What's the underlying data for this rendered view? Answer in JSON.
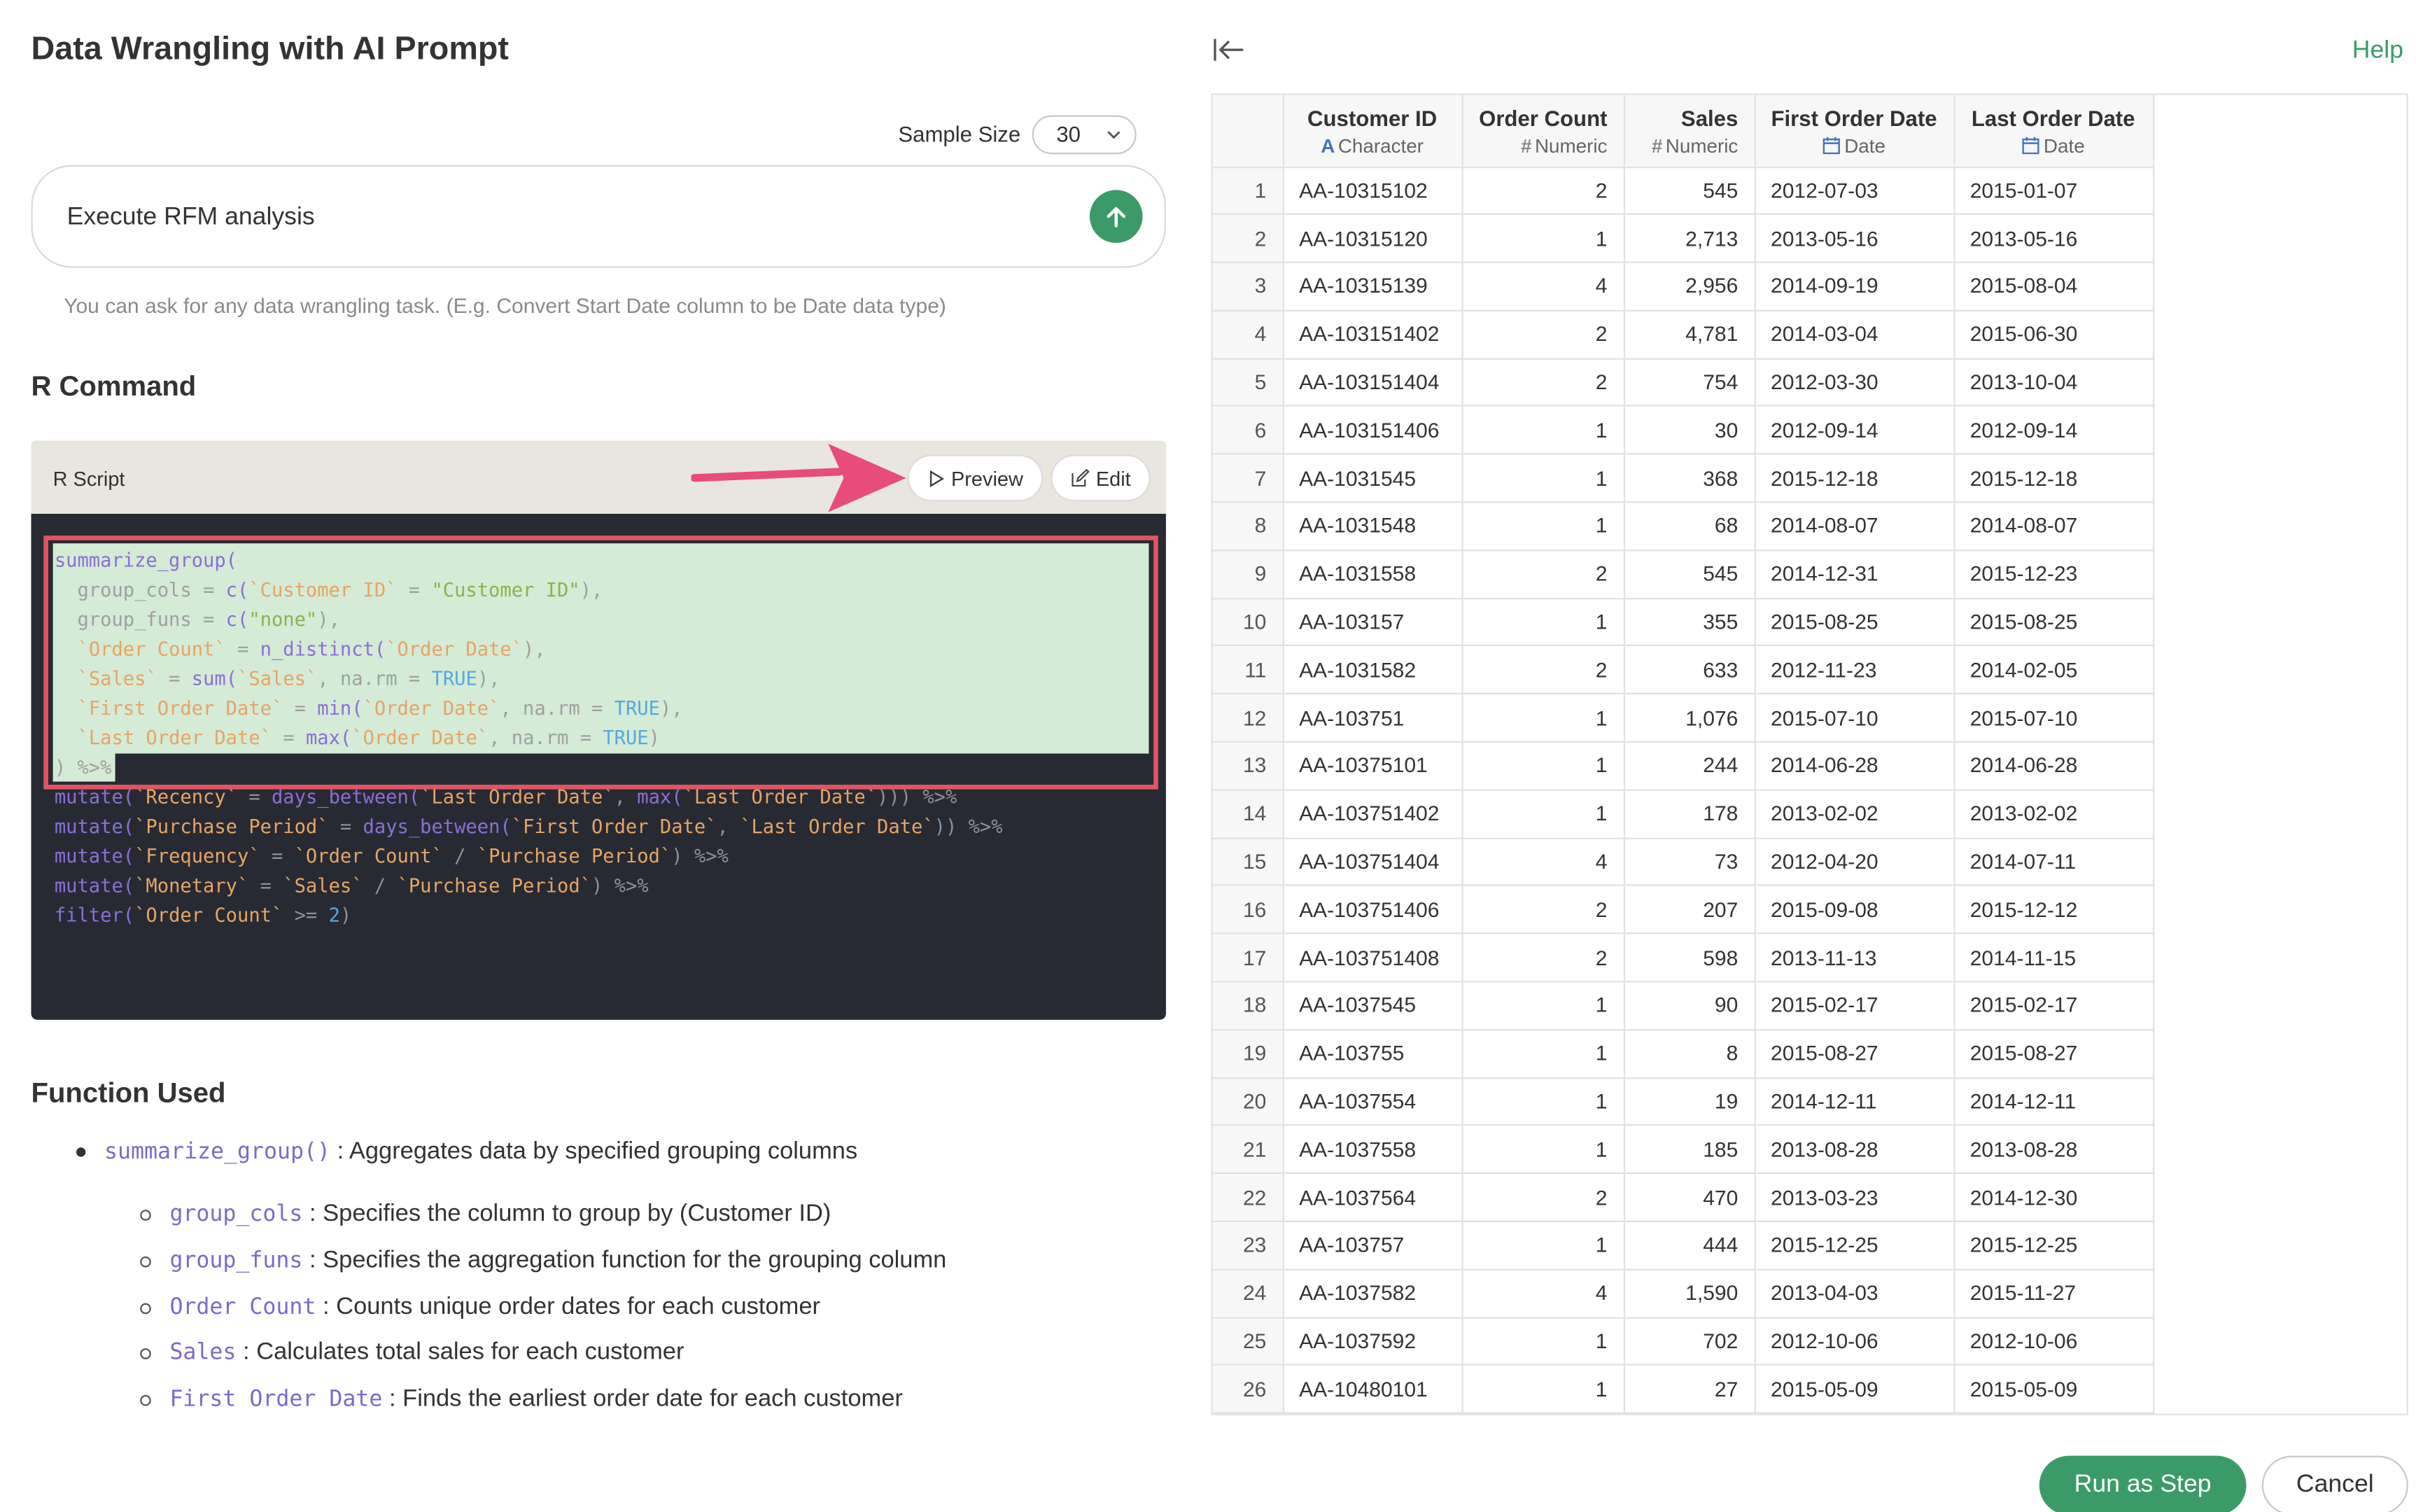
{
  "header": {
    "title": "Data Wrangling with AI Prompt",
    "help_label": "Help"
  },
  "sample": {
    "label": "Sample Size",
    "value": "30"
  },
  "prompt": {
    "text": "Execute RFM analysis",
    "hint": "You can ask for any data wrangling task. (E.g. Convert Start Date column to be Date data type)"
  },
  "r_command": {
    "heading": "R Command",
    "script_label": "R Script",
    "preview_label": "Preview",
    "edit_label": "Edit"
  },
  "code": {
    "l1": "summarize_group(",
    "l2a": "  group_cols = ",
    "l2b": "c(",
    "l2c": "`Customer ID`",
    "l2d": " = ",
    "l2e": "\"Customer ID\"",
    "l2f": "),",
    "l3a": "  group_funs = ",
    "l3b": "c(",
    "l3c": "\"none\"",
    "l3d": "),",
    "l4a": "  ",
    "l4b": "`Order Count`",
    "l4c": " = ",
    "l4d": "n_distinct(",
    "l4e": "`Order Date`",
    "l4f": "),",
    "l5a": "  ",
    "l5b": "`Sales`",
    "l5c": " = ",
    "l5d": "sum(",
    "l5e": "`Sales`",
    "l5f": ", na.rm = ",
    "l5g": "TRUE",
    "l5h": "),",
    "l6a": "  ",
    "l6b": "`First Order Date`",
    "l6c": " = ",
    "l6d": "min(",
    "l6e": "`Order Date`",
    "l6f": ", na.rm = ",
    "l6g": "TRUE",
    "l6h": "),",
    "l7a": "  ",
    "l7b": "`Last Order Date`",
    "l7c": " = ",
    "l7d": "max(",
    "l7e": "`Order Date`",
    "l7f": ", na.rm = ",
    "l7g": "TRUE",
    "l7h": ")",
    "l8": ") %>%",
    "l9a": "mutate(",
    "l9b": "`Recency`",
    "l9c": " = ",
    "l9d": "days_between(",
    "l9e": "`Last Order Date`",
    "l9f": ", ",
    "l9g": "max(",
    "l9h": "`Last Order Date`",
    "l9i": "))) %>%",
    "l10a": "mutate(",
    "l10b": "`Purchase Period`",
    "l10c": " = ",
    "l10d": "days_between(",
    "l10e": "`First Order Date`",
    "l10f": ", ",
    "l10g": "`Last Order Date`",
    "l10h": ")) %>%",
    "l11a": "mutate(",
    "l11b": "`Frequency`",
    "l11c": " = ",
    "l11d": "`Order Count`",
    "l11e": " / ",
    "l11f": "`Purchase Period`",
    "l11g": ") %>%",
    "l12a": "mutate(",
    "l12b": "`Monetary`",
    "l12c": " = ",
    "l12d": "`Sales`",
    "l12e": " / ",
    "l12f": "`Purchase Period`",
    "l12g": ") %>%",
    "l13a": "filter(",
    "l13b": "`Order Count`",
    "l13c": " >= ",
    "l13d": "2",
    "l13e": ")"
  },
  "functions": {
    "heading": "Function Used",
    "main": {
      "name": "summarize_group()",
      "desc": " : Aggregates data by specified grouping columns"
    },
    "items": [
      {
        "name": "group_cols",
        "desc": " : Specifies the column to group by (Customer ID)"
      },
      {
        "name": "group_funs",
        "desc": " : Specifies the aggregation function for the grouping column"
      },
      {
        "name": "Order Count",
        "desc": " : Counts unique order dates for each customer"
      },
      {
        "name": "Sales",
        "desc": " : Calculates total sales for each customer"
      },
      {
        "name": "First Order Date",
        "desc": " : Finds the earliest order date for each customer"
      }
    ]
  },
  "table": {
    "columns": [
      {
        "name": "Customer ID",
        "type": "Character",
        "type_icon": "A"
      },
      {
        "name": "Order Count",
        "type": "Numeric",
        "type_icon": "#"
      },
      {
        "name": "Sales",
        "type": "Numeric",
        "type_icon": "#"
      },
      {
        "name": "First Order Date",
        "type": "Date",
        "type_icon": "calendar-icon"
      },
      {
        "name": "Last Order Date",
        "type": "Date",
        "type_icon": "calendar-icon"
      }
    ],
    "rows": [
      [
        "1",
        "AA-10315102",
        "2",
        "545",
        "2012-07-03",
        "2015-01-07"
      ],
      [
        "2",
        "AA-10315120",
        "1",
        "2,713",
        "2013-05-16",
        "2013-05-16"
      ],
      [
        "3",
        "AA-10315139",
        "4",
        "2,956",
        "2014-09-19",
        "2015-08-04"
      ],
      [
        "4",
        "AA-103151402",
        "2",
        "4,781",
        "2014-03-04",
        "2015-06-30"
      ],
      [
        "5",
        "AA-103151404",
        "2",
        "754",
        "2012-03-30",
        "2013-10-04"
      ],
      [
        "6",
        "AA-103151406",
        "1",
        "30",
        "2012-09-14",
        "2012-09-14"
      ],
      [
        "7",
        "AA-1031545",
        "1",
        "368",
        "2015-12-18",
        "2015-12-18"
      ],
      [
        "8",
        "AA-1031548",
        "1",
        "68",
        "2014-08-07",
        "2014-08-07"
      ],
      [
        "9",
        "AA-1031558",
        "2",
        "545",
        "2014-12-31",
        "2015-12-23"
      ],
      [
        "10",
        "AA-103157",
        "1",
        "355",
        "2015-08-25",
        "2015-08-25"
      ],
      [
        "11",
        "AA-1031582",
        "2",
        "633",
        "2012-11-23",
        "2014-02-05"
      ],
      [
        "12",
        "AA-103751",
        "1",
        "1,076",
        "2015-07-10",
        "2015-07-10"
      ],
      [
        "13",
        "AA-10375101",
        "1",
        "244",
        "2014-06-28",
        "2014-06-28"
      ],
      [
        "14",
        "AA-103751402",
        "1",
        "178",
        "2013-02-02",
        "2013-02-02"
      ],
      [
        "15",
        "AA-103751404",
        "4",
        "73",
        "2012-04-20",
        "2014-07-11"
      ],
      [
        "16",
        "AA-103751406",
        "2",
        "207",
        "2015-09-08",
        "2015-12-12"
      ],
      [
        "17",
        "AA-103751408",
        "2",
        "598",
        "2013-11-13",
        "2014-11-15"
      ],
      [
        "18",
        "AA-1037545",
        "1",
        "90",
        "2015-02-17",
        "2015-02-17"
      ],
      [
        "19",
        "AA-103755",
        "1",
        "8",
        "2015-08-27",
        "2015-08-27"
      ],
      [
        "20",
        "AA-1037554",
        "1",
        "19",
        "2014-12-11",
        "2014-12-11"
      ],
      [
        "21",
        "AA-1037558",
        "1",
        "185",
        "2013-08-28",
        "2013-08-28"
      ],
      [
        "22",
        "AA-1037564",
        "2",
        "470",
        "2013-03-23",
        "2014-12-30"
      ],
      [
        "23",
        "AA-103757",
        "1",
        "444",
        "2015-12-25",
        "2015-12-25"
      ],
      [
        "24",
        "AA-1037582",
        "4",
        "1,590",
        "2013-04-03",
        "2015-11-27"
      ],
      [
        "25",
        "AA-1037592",
        "1",
        "702",
        "2012-10-06",
        "2012-10-06"
      ],
      [
        "26",
        "AA-10480101",
        "1",
        "27",
        "2015-05-09",
        "2015-05-09"
      ]
    ]
  },
  "actions": {
    "run_label": "Run as Step",
    "cancel_label": "Cancel"
  },
  "colors": {
    "accent": "#3b9b68",
    "highlight": "#d4ebd6",
    "annotation": "#e05563",
    "code_bg": "#272a33"
  }
}
